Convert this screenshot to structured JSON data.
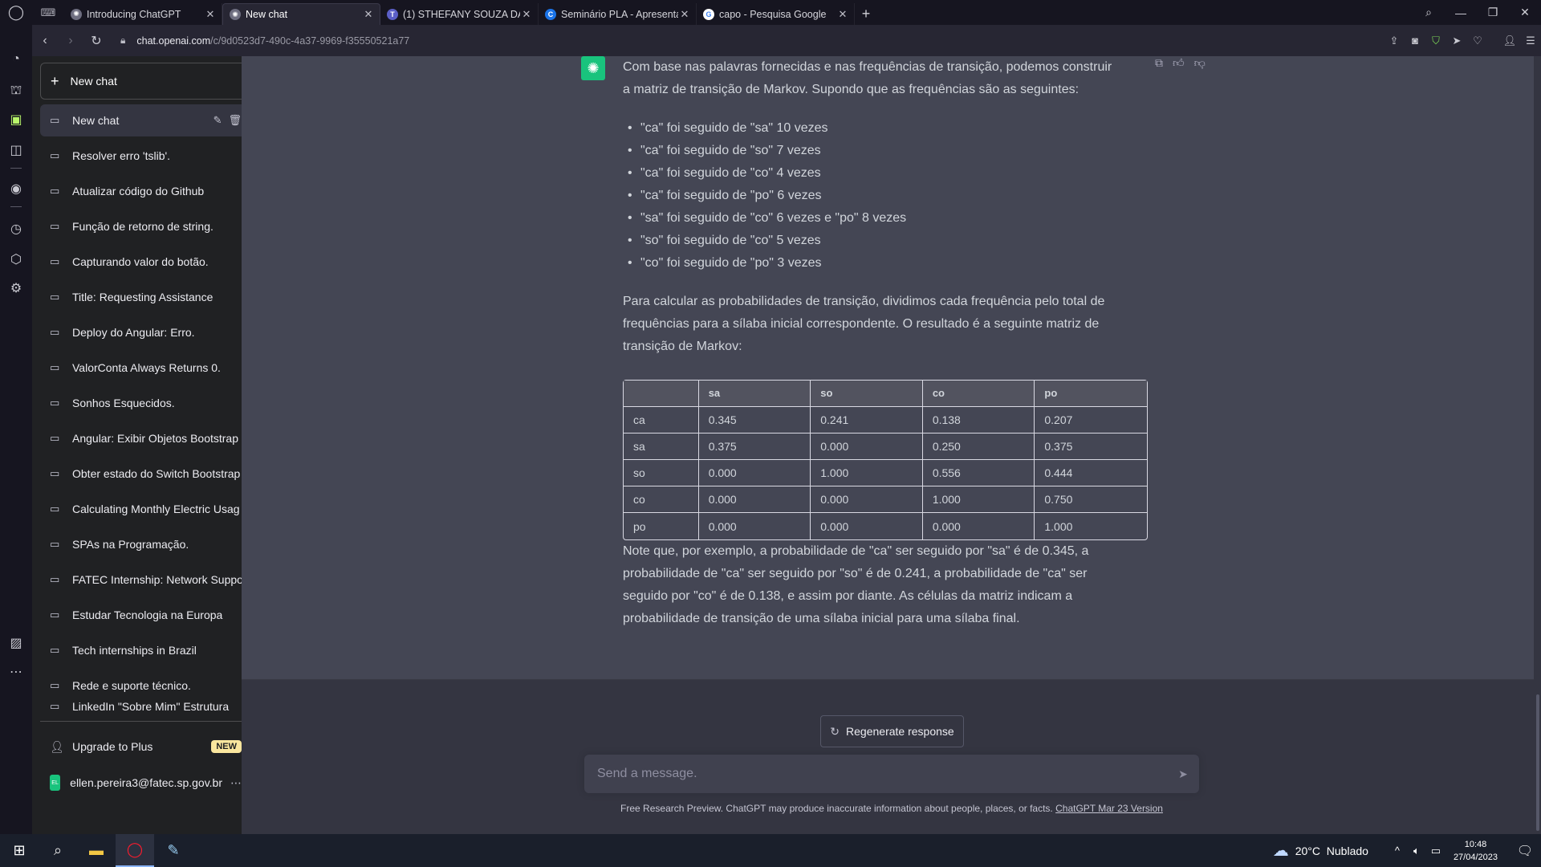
{
  "browser": {
    "tabs": [
      {
        "title": "Introducing ChatGPT",
        "active": false
      },
      {
        "title": "New chat",
        "active": true
      },
      {
        "title": "(1) STHEFANY SOUZA DA S",
        "active": false
      },
      {
        "title": "Seminário PLA - Apresenta",
        "active": false
      },
      {
        "title": "capo - Pesquisa Google",
        "active": false
      }
    ],
    "url_host": "chat.openai.com",
    "url_path": "/c/9d0523d7-490c-4a37-9969-f35550521a77"
  },
  "sidebar": {
    "new_chat_label": "New chat",
    "conversations": [
      "New chat",
      "Resolver erro 'tslib'.",
      "Atualizar código do Github",
      "Função de retorno de string.",
      "Capturando valor do botão.",
      "Title: Requesting Assistance",
      "Deploy do Angular: Erro.",
      "ValorConta Always Returns 0.",
      "Sonhos Esquecidos.",
      "Angular: Exibir Objetos Bootstrap",
      "Obter estado do Switch Bootstrap",
      "Calculating Monthly Electric Usag",
      "SPAs na Programação.",
      "FATEC Internship: Network Suppo",
      "Estudar Tecnologia na Europa",
      "Tech internships in Brazil",
      "Rede e suporte técnico.",
      "LinkedIn \"Sobre Mim\" Estrutura"
    ],
    "upgrade_label": "Upgrade to Plus",
    "upgrade_badge": "NEW",
    "account_initials": "EL",
    "account_email": "ellen.pereira3@fatec.sp.gov.br"
  },
  "message": {
    "intro": "Com base nas palavras fornecidas e nas frequências de transição, podemos construir a matriz de transição de Markov. Supondo que as frequências são as seguintes:",
    "bullets": [
      "\"ca\" foi seguido de \"sa\" 10 vezes",
      "\"ca\" foi seguido de \"so\" 7 vezes",
      "\"ca\" foi seguido de \"co\" 4 vezes",
      "\"ca\" foi seguido de \"po\" 6 vezes",
      "\"sa\" foi seguido de \"co\" 6 vezes e \"po\" 8 vezes",
      "\"so\" foi seguido de \"co\" 5 vezes",
      "\"co\" foi seguido de \"po\" 3 vezes"
    ],
    "paragraph2": "Para calcular as probabilidades de transição, dividimos cada frequência pelo total de frequências para a sílaba inicial correspondente. O resultado é a seguinte matriz de transição de Markov:",
    "table": {
      "headers": [
        "",
        "sa",
        "so",
        "co",
        "po"
      ],
      "rows": [
        [
          "ca",
          "0.345",
          "0.241",
          "0.138",
          "0.207"
        ],
        [
          "sa",
          "0.375",
          "0.000",
          "0.250",
          "0.375"
        ],
        [
          "so",
          "0.000",
          "1.000",
          "0.556",
          "0.444"
        ],
        [
          "co",
          "0.000",
          "0.000",
          "1.000",
          "0.750"
        ],
        [
          "po",
          "0.000",
          "0.000",
          "0.000",
          "1.000"
        ]
      ]
    },
    "note": "Note que, por exemplo, a probabilidade de \"ca\" ser seguido por \"sa\" é de 0.345, a probabilidade de \"ca\" ser seguido por \"so\" é de 0.241, a probabilidade de \"ca\" ser seguido por \"co\" é de 0.138, e assim por diante. As células da matriz indicam a probabilidade de transição de uma sílaba inicial para uma sílaba final."
  },
  "composer": {
    "regenerate_label": "Regenerate response",
    "placeholder": "Send a message.",
    "disclaimer": "Free Research Preview. ChatGPT may produce inaccurate information about people, places, or facts.",
    "version_link": "ChatGPT Mar 23 Version"
  },
  "taskbar": {
    "temperature": "20°C",
    "weather": "Nublado",
    "time": "10:48",
    "date": "27/04/2023"
  },
  "colors": {
    "accent_green": "#19c37d",
    "sidebar_bg": "#202123",
    "main_bg": "#343541",
    "assistant_bg": "#444654"
  }
}
